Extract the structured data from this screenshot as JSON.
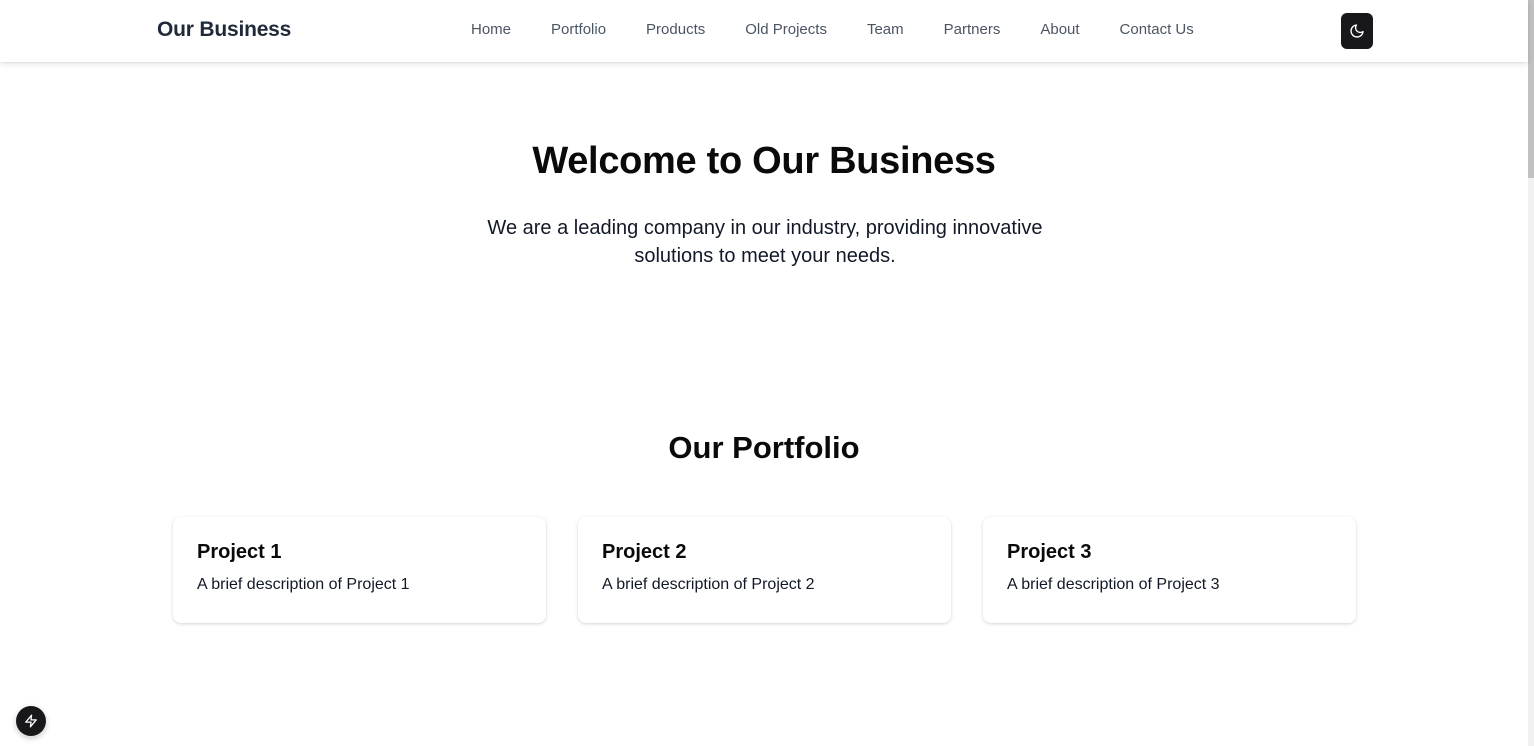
{
  "header": {
    "brand": "Our Business",
    "nav": [
      "Home",
      "Portfolio",
      "Products",
      "Old Projects",
      "Team",
      "Partners",
      "About",
      "Contact Us"
    ],
    "theme_toggle_icon": "moon-icon"
  },
  "hero": {
    "title": "Welcome to Our Business",
    "subtitle": "We are a leading company in our industry, providing innovative solutions to meet your needs."
  },
  "portfolio": {
    "title": "Our Portfolio",
    "projects": [
      {
        "title": "Project 1",
        "description": "A brief description of Project 1"
      },
      {
        "title": "Project 2",
        "description": "A brief description of Project 2"
      },
      {
        "title": "Project 3",
        "description": "A brief description of Project 3"
      }
    ]
  },
  "dev_badge_icon": "lightning-icon",
  "colors": {
    "accent_dark": "#18181b",
    "nav_text": "#4b5563",
    "heading": "#0a0a0a"
  }
}
